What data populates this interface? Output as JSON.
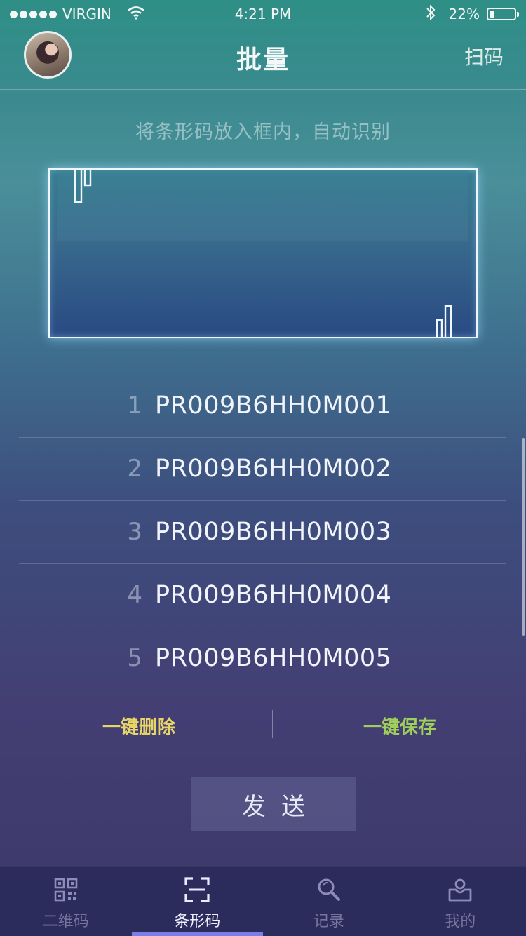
{
  "status_bar": {
    "carrier": "VIRGIN",
    "time": "4:21 PM",
    "battery": "22%",
    "battery_level": 0.22,
    "icons": [
      "signal-dots-icon",
      "wifi-icon",
      "bluetooth-icon",
      "battery-icon"
    ]
  },
  "nav": {
    "title": "批量",
    "right_action": "扫码",
    "avatar_icon": "user-avatar"
  },
  "scanner": {
    "hint": "将条形码放入框内，自动识别"
  },
  "codes": [
    {
      "index": "1",
      "code": "PR009B6HH0M001"
    },
    {
      "index": "2",
      "code": "PR009B6HH0M002"
    },
    {
      "index": "3",
      "code": "PR009B6HH0M003"
    },
    {
      "index": "4",
      "code": "PR009B6HH0M004"
    },
    {
      "index": "5",
      "code": "PR009B6HH0M005"
    }
  ],
  "actions": {
    "delete_all": "一键删除",
    "save_all": "一键保存"
  },
  "send": {
    "label": "发送"
  },
  "tabs": [
    {
      "label": "二维码",
      "icon": "qr-code-icon",
      "active": false
    },
    {
      "label": "条形码",
      "icon": "barcode-scan-icon",
      "active": true
    },
    {
      "label": "记录",
      "icon": "search-icon",
      "active": false
    },
    {
      "label": "我的",
      "icon": "profile-inbox-icon",
      "active": false
    }
  ],
  "colors": {
    "delete_accent": "#e7d567",
    "save_accent": "#9fcf5a",
    "tab_active_indicator": "#7b7ee8",
    "tab_bar_bg": "#2b2b5c"
  }
}
